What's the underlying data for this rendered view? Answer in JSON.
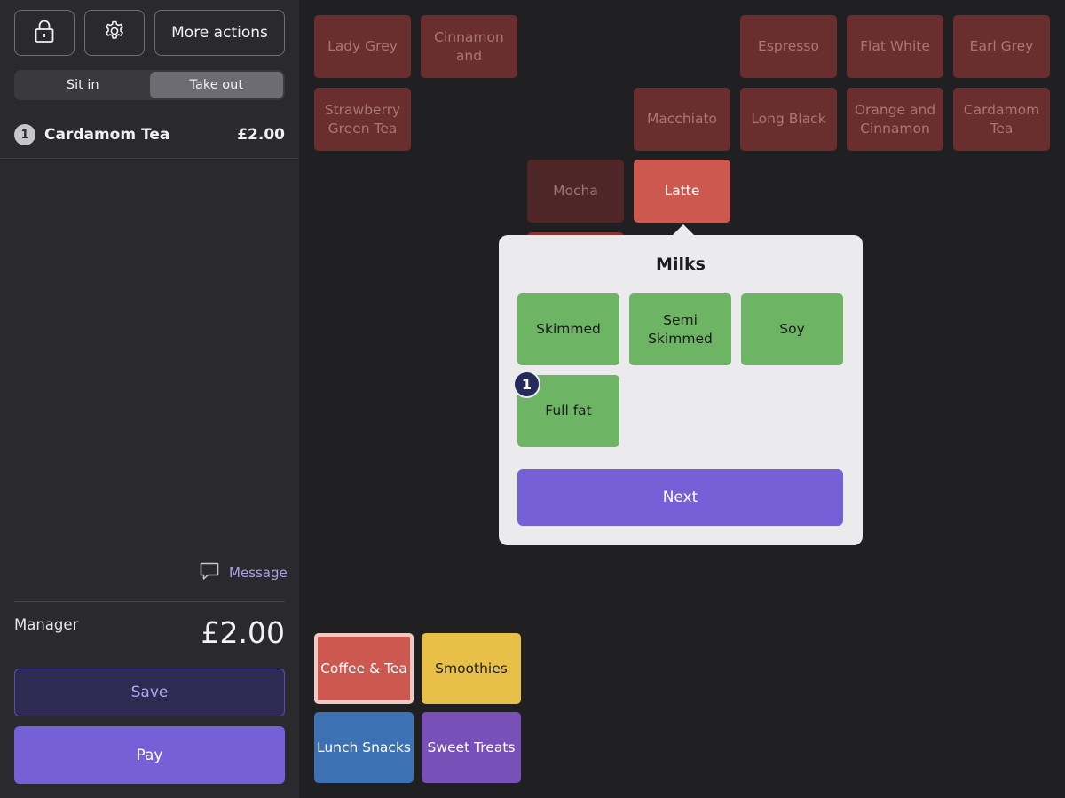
{
  "header": {
    "lock_icon": "lock-icon",
    "settings_icon": "gear-icon",
    "more_actions_label": "More actions"
  },
  "order_type": {
    "options": [
      "Sit in",
      "Take out"
    ],
    "selected": "Take out"
  },
  "order": {
    "items": [
      {
        "quantity": "1",
        "name": "Cardamom Tea",
        "price": "£2.00"
      }
    ],
    "message_label": "Message",
    "staff": "Manager",
    "total": "£2.00",
    "save_label": "Save",
    "pay_label": "Pay"
  },
  "products": [
    {
      "label": "Lady Grey",
      "state": "dim"
    },
    {
      "label": "Cinnamon and",
      "state": "dim"
    },
    {
      "label": "Espresso",
      "state": "dim"
    },
    {
      "label": "Flat White",
      "state": "dim"
    },
    {
      "label": "Earl Grey",
      "state": "dim"
    },
    {
      "label": "Strawberry Green Tea",
      "state": "dim"
    },
    {
      "label": "Macchiato",
      "state": "dim"
    },
    {
      "label": "Long Black",
      "state": "dim"
    },
    {
      "label": "Orange and Cinnamon",
      "state": "dim"
    },
    {
      "label": "Cardamom Tea",
      "state": "dim"
    },
    {
      "label": "Mocha",
      "state": "dim"
    },
    {
      "label": "Latte",
      "state": "selected"
    }
  ],
  "categories": [
    {
      "label": "Coffee & Tea",
      "color": "#cc5850",
      "active": true
    },
    {
      "label": "Smoothies",
      "color": "#e8c048",
      "active": false
    },
    {
      "label": "Lunch Snacks",
      "color": "#3c72b4",
      "active": false
    },
    {
      "label": "Sweet Treats",
      "color": "#7850b8",
      "active": false
    }
  ],
  "modifier_popover": {
    "title": "Milks",
    "options": [
      {
        "label": "Skimmed",
        "count": ""
      },
      {
        "label": "Semi Skimmed",
        "count": ""
      },
      {
        "label": "Soy",
        "count": ""
      },
      {
        "label": "Full fat",
        "count": "1"
      }
    ],
    "next_label": "Next"
  },
  "colors": {
    "accent_purple": "#7660d8",
    "modifier_green": "#6db464",
    "product_dim": "#6b2e2f",
    "product_selected": "#cc5850"
  }
}
